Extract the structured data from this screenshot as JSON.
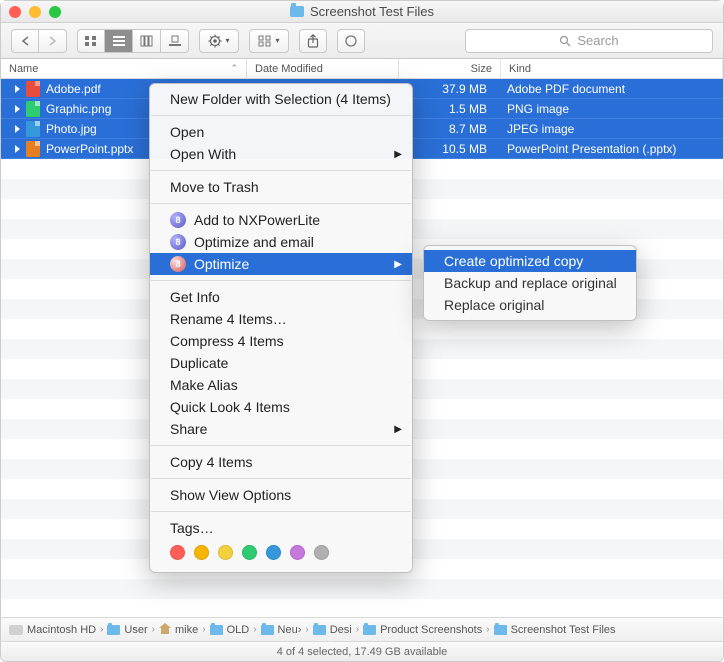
{
  "window": {
    "title": "Screenshot Test Files"
  },
  "toolbar": {
    "search_placeholder": "Search"
  },
  "columns": {
    "name": "Name",
    "date": "Date Modified",
    "size": "Size",
    "kind": "Kind"
  },
  "files": [
    {
      "name": "Adobe.pdf",
      "size": "37.9 MB",
      "kind": "Adobe PDF document",
      "icon": "pdf"
    },
    {
      "name": "Graphic.png",
      "size": "1.5 MB",
      "kind": "PNG image",
      "icon": "png"
    },
    {
      "name": "Photo.jpg",
      "size": "8.7 MB",
      "kind": "JPEG image",
      "icon": "jpg"
    },
    {
      "name": "PowerPoint.pptx",
      "size": "10.5 MB",
      "kind": "PowerPoint Presentation (.pptx)",
      "icon": "pptx"
    }
  ],
  "context_menu": {
    "new_folder": "New Folder with Selection (4 Items)",
    "open": "Open",
    "open_with": "Open With",
    "move_to_trash": "Move to Trash",
    "add_to_nx": "Add to NXPowerLite",
    "optimize_email": "Optimize and email",
    "optimize": "Optimize",
    "get_info": "Get Info",
    "rename": "Rename 4 Items…",
    "compress": "Compress 4 Items",
    "duplicate": "Duplicate",
    "make_alias": "Make Alias",
    "quick_look": "Quick Look 4 Items",
    "share": "Share",
    "copy": "Copy 4 Items",
    "view_options": "Show View Options",
    "tags": "Tags…",
    "tag_colors": [
      "#ff5f57",
      "#f7b500",
      "#f4d03f",
      "#2ecc71",
      "#3498db",
      "#c678dd",
      "#b0b0b0"
    ]
  },
  "submenu": {
    "create_copy": "Create optimized copy",
    "backup_replace": "Backup and replace original",
    "replace": "Replace original"
  },
  "path": [
    {
      "label": "Macintosh HD",
      "icon": "hd"
    },
    {
      "label": "User",
      "icon": "fold"
    },
    {
      "label": "mike",
      "icon": "home"
    },
    {
      "label": "OLD",
      "icon": "fold"
    },
    {
      "label": "Neu›",
      "icon": "fold"
    },
    {
      "label": "Desi",
      "icon": "fold"
    },
    {
      "label": "Product Screenshots",
      "icon": "fold"
    },
    {
      "label": "Screenshot Test Files",
      "icon": "fold"
    }
  ],
  "status": "4 of 4 selected, 17.49 GB available"
}
